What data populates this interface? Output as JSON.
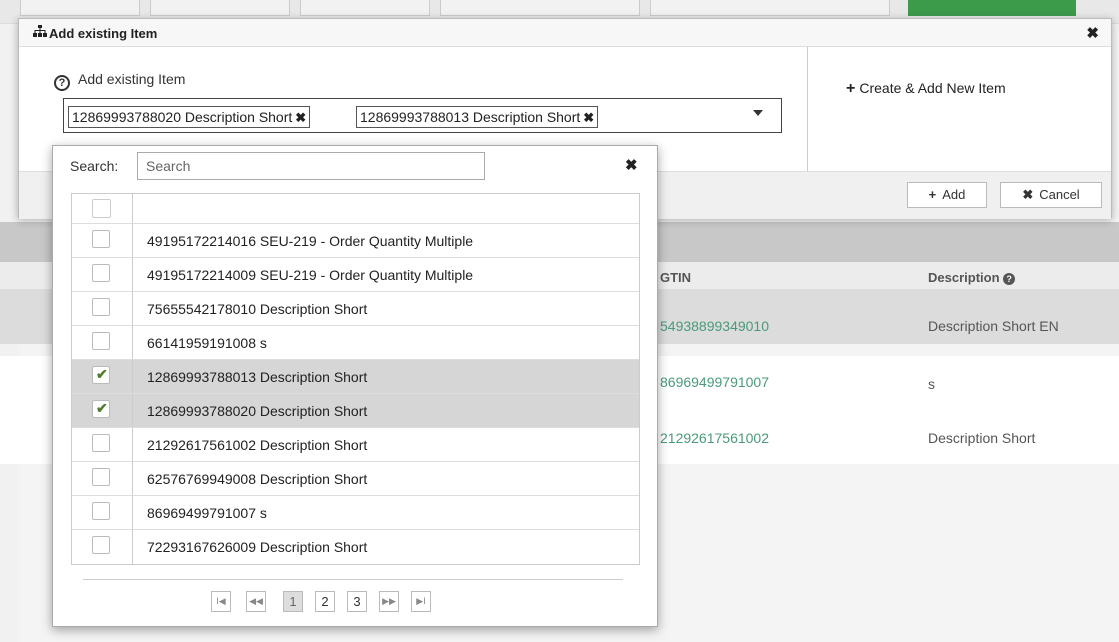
{
  "modal": {
    "title": "Add existing Item",
    "title_icon": "sitemap-icon",
    "close_icon": "close-icon",
    "field_label": "Add existing Item",
    "help_icon": "question-circle-icon",
    "selected_tags": [
      {
        "label": "12869993788020 Description Short"
      },
      {
        "label": "12869993788013 Description Short"
      }
    ],
    "create_new_label": "Create & Add New Item",
    "add_label": "Add",
    "cancel_label": "Cancel"
  },
  "dropdown": {
    "search_label": "Search:",
    "search_placeholder": "Search",
    "items": [
      {
        "label": "49195172214016 SEU-219 - Order Quantity Multiple",
        "checked": false
      },
      {
        "label": "49195172214009 SEU-219 - Order Quantity Multiple",
        "checked": false
      },
      {
        "label": "75655542178010 Description Short",
        "checked": false
      },
      {
        "label": "66141959191008 s",
        "checked": false
      },
      {
        "label": "12869993788013 Description Short",
        "checked": true
      },
      {
        "label": "12869993788020 Description Short",
        "checked": true
      },
      {
        "label": "21292617561002 Description Short",
        "checked": false
      },
      {
        "label": "62576769949008 Description Short",
        "checked": false
      },
      {
        "label": "86969499791007 s",
        "checked": false
      },
      {
        "label": "72293167626009 Description Short",
        "checked": false
      }
    ],
    "pager": {
      "first": "I◀",
      "prev": "◀◀",
      "pages": [
        "1",
        "2",
        "3"
      ],
      "current_page": "1",
      "next": "▶▶",
      "last": "▶I"
    }
  },
  "background_table": {
    "columns": [
      "GTIN",
      "Description"
    ],
    "rows": [
      {
        "gtin": "54938899349010",
        "description": "Description Short EN"
      },
      {
        "gtin": "86969499791007",
        "description": "s"
      },
      {
        "gtin": "21292617561002",
        "description": "Description Short"
      }
    ],
    "accent_color": "#4a9a7a"
  }
}
